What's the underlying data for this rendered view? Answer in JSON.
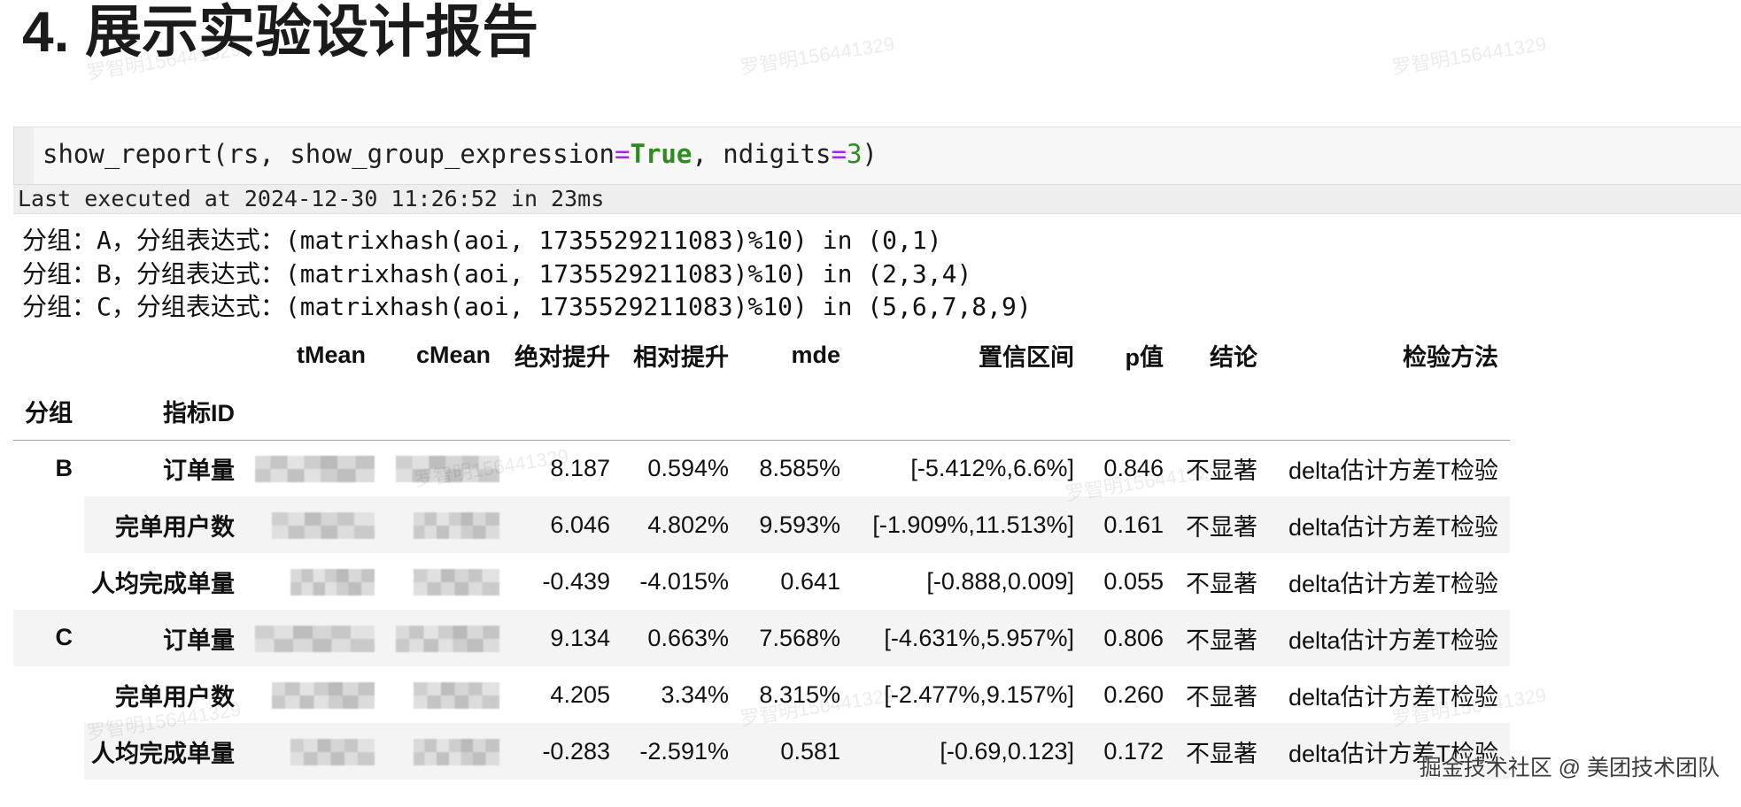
{
  "heading": "4. 展示实验设计报告",
  "code_cell": {
    "parts": [
      "show_report(rs, show_group_expression",
      "=",
      "True",
      ", ndigits",
      "=",
      "3",
      ")"
    ],
    "execution_info": "Last executed at 2024-12-30 11:26:52 in 23ms"
  },
  "output": {
    "stdout": [
      "分组：A，分组表达式：(matrixhash(aoi, 1735529211083)%10) in (0,1)",
      "分组：B，分组表达式：(matrixhash(aoi, 1735529211083)%10) in (2,3,4)",
      "分组：C，分组表达式：(matrixhash(aoi, 1735529211083)%10) in (5,6,7,8,9)"
    ],
    "table": {
      "index_names": [
        "分组",
        "指标ID"
      ],
      "columns": [
        "tMean",
        "cMean",
        "绝对提升",
        "相对提升",
        "mde",
        "置信区间",
        "p值",
        "结论",
        "检验方法"
      ],
      "groups": [
        {
          "group": "B",
          "rows": [
            {
              "metric": "订单量",
              "values": [
                null,
                null,
                "8.187",
                "0.594%",
                "8.585%",
                "[-5.412%,6.6%]",
                "0.846",
                "不显著",
                "delta估计方差T检验"
              ]
            },
            {
              "metric": "完单用户数",
              "values": [
                null,
                null,
                "6.046",
                "4.802%",
                "9.593%",
                "[-1.909%,11.513%]",
                "0.161",
                "不显著",
                "delta估计方差T检验"
              ]
            },
            {
              "metric": "人均完成单量",
              "values": [
                null,
                null,
                "-0.439",
                "-4.015%",
                "0.641",
                "[-0.888,0.009]",
                "0.055",
                "不显著",
                "delta估计方差T检验"
              ]
            }
          ]
        },
        {
          "group": "C",
          "rows": [
            {
              "metric": "订单量",
              "values": [
                null,
                null,
                "9.134",
                "0.663%",
                "7.568%",
                "[-4.631%,5.957%]",
                "0.806",
                "不显著",
                "delta估计方差T检验"
              ]
            },
            {
              "metric": "完单用户数",
              "values": [
                null,
                null,
                "4.205",
                "3.34%",
                "8.315%",
                "[-2.477%,9.157%]",
                "0.260",
                "不显著",
                "delta估计方差T检验"
              ]
            },
            {
              "metric": "人均完成单量",
              "values": [
                null,
                null,
                "-0.283",
                "-2.591%",
                "0.581",
                "[-0.69,0.123]",
                "0.172",
                "不显著",
                "delta估计方差T检验"
              ]
            }
          ]
        }
      ]
    }
  },
  "watermark": "罗智明156441329",
  "attribution": "掘金技术社区 @ 美团技术团队",
  "colors": {
    "operator": "#aa22ff",
    "keyword": "#2e8b1e",
    "number": "#2e8b1e",
    "row_stripe": "#f4f4f4"
  }
}
